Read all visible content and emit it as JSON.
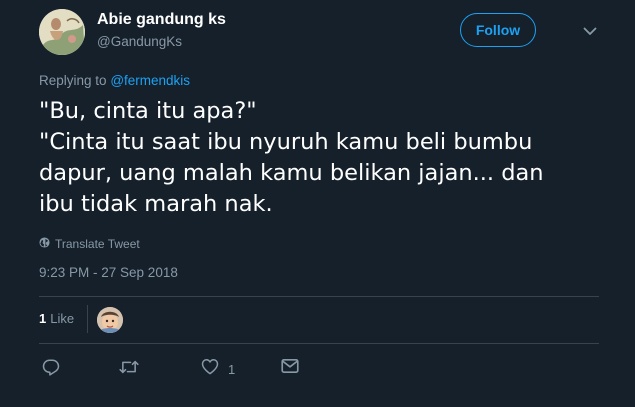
{
  "author": {
    "display_name": "Abie gandung ks",
    "handle": "@GandungKs"
  },
  "header": {
    "follow_label": "Follow",
    "caret_icon": "chevron-down-icon"
  },
  "reply": {
    "prefix": "Replying to",
    "mention": "@fermendkis"
  },
  "tweet": {
    "lines": [
      "\"Bu, cinta itu apa?\"",
      "\"Cinta itu saat ibu nyuruh kamu beli bumbu",
      "dapur, uang malah kamu belikan jajan... dan",
      "ibu tidak marah nak."
    ],
    "translate_label": "Translate Tweet",
    "timestamp": "9:23 PM - 27 Sep 2018"
  },
  "stats": {
    "like_count": "1",
    "like_label": "Like"
  },
  "actions": {
    "reply_icon": "reply-icon",
    "retweet_icon": "retweet-icon",
    "like_icon": "heart-icon",
    "like_count": "1",
    "dm_icon": "mail-icon"
  },
  "colors": {
    "background": "#15202b",
    "accent": "#1da1f2",
    "secondary_text": "#8899a6",
    "divider": "#38444d"
  }
}
